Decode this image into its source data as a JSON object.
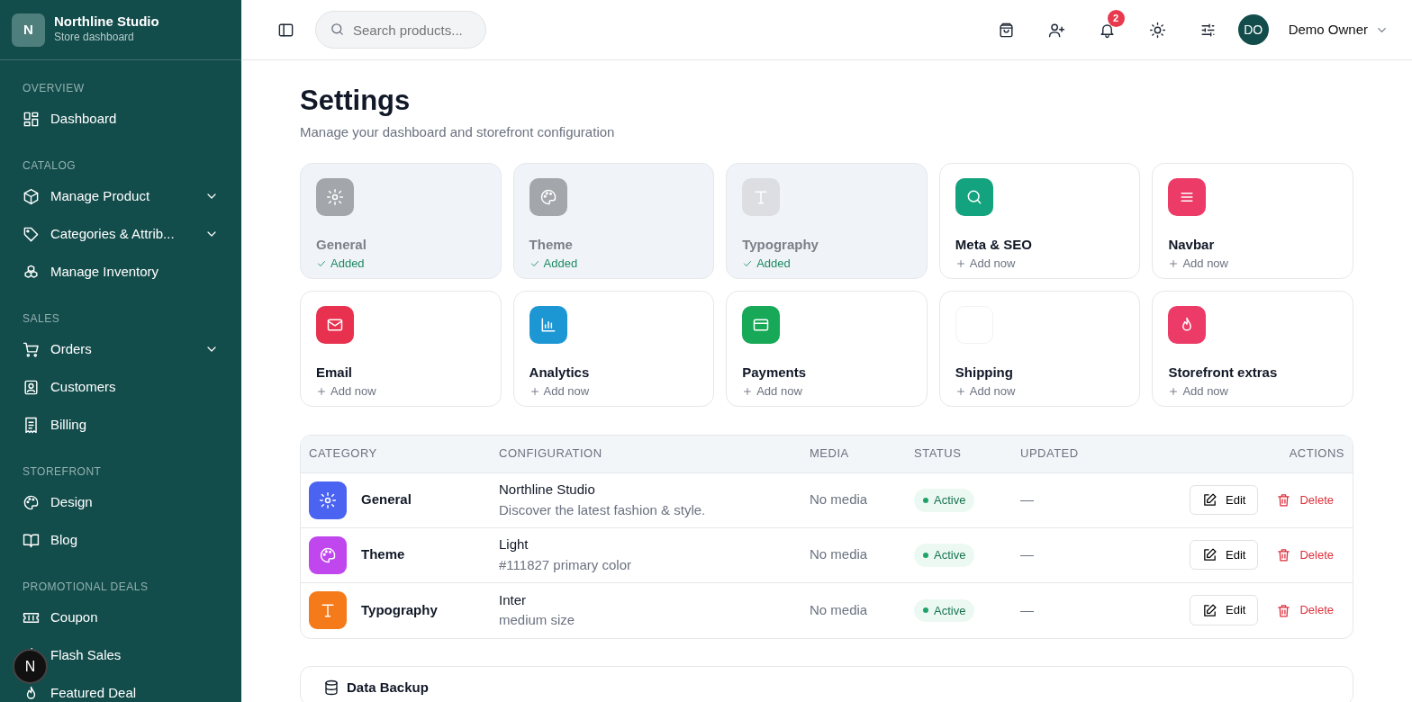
{
  "brand": {
    "initial": "N",
    "name": "Northline Studio",
    "subtitle": "Store dashboard"
  },
  "sidebar": {
    "sections": [
      {
        "title": "OVERVIEW",
        "items": [
          {
            "label": "Dashboard",
            "expandable": false
          }
        ]
      },
      {
        "title": "CATALOG",
        "items": [
          {
            "label": "Manage Product",
            "expandable": true
          },
          {
            "label": "Categories & Attrib...",
            "expandable": true
          },
          {
            "label": "Manage Inventory",
            "expandable": false
          }
        ]
      },
      {
        "title": "SALES",
        "items": [
          {
            "label": "Orders",
            "expandable": true
          },
          {
            "label": "Customers",
            "expandable": false
          },
          {
            "label": "Billing",
            "expandable": false
          }
        ]
      },
      {
        "title": "STOREFRONT",
        "items": [
          {
            "label": "Design",
            "expandable": false
          },
          {
            "label": "Blog",
            "expandable": false
          }
        ]
      },
      {
        "title": "PROMOTIONAL DEALS",
        "items": [
          {
            "label": "Coupon",
            "expandable": false
          },
          {
            "label": "Flash Sales",
            "expandable": false
          },
          {
            "label": "Featured Deal",
            "expandable": false
          }
        ]
      }
    ]
  },
  "dev_badge": "N",
  "topbar": {
    "search": {
      "placeholder": "Search products..."
    },
    "notification_count": "2",
    "user": {
      "initials": "DO",
      "name": "Demo Owner"
    }
  },
  "page": {
    "title": "Settings",
    "subtitle": "Manage your dashboard and storefront configuration"
  },
  "modules": [
    {
      "name": "General",
      "status": "Added",
      "added": true,
      "color": "#a3a6ab"
    },
    {
      "name": "Theme",
      "status": "Added",
      "added": true,
      "color": "#a3a6ab"
    },
    {
      "name": "Typography",
      "status": "Added",
      "added": true,
      "color": "#dcdee1"
    },
    {
      "name": "Meta & SEO",
      "status": "Add now",
      "added": false,
      "color": "#14a37f"
    },
    {
      "name": "Navbar",
      "status": "Add now",
      "added": false,
      "color": "#ec3b66"
    },
    {
      "name": "Email",
      "status": "Add now",
      "added": false,
      "color": "#e8314f"
    },
    {
      "name": "Analytics",
      "status": "Add now",
      "added": false,
      "color": "#1d97d4"
    },
    {
      "name": "Payments",
      "status": "Add now",
      "added": false,
      "color": "#17a957"
    },
    {
      "name": "Shipping",
      "status": "Add now",
      "added": false,
      "color": "#ffffff"
    },
    {
      "name": "Storefront extras",
      "status": "Add now",
      "added": false,
      "color": "#ec3b66"
    }
  ],
  "table": {
    "columns": [
      "CATEGORY",
      "CONFIGURATION",
      "MEDIA",
      "STATUS",
      "UPDATED",
      "ACTIONS"
    ],
    "rows": [
      {
        "category": "General",
        "color": "#4a63f0",
        "config_title": "Northline Studio",
        "config_detail": "Discover the latest fashion & style.",
        "media": "No media",
        "status": "Active",
        "updated": "—",
        "edit": "Edit",
        "delete": "Delete"
      },
      {
        "category": "Theme",
        "color": "#c046ee",
        "config_title": "Light",
        "config_detail": "#111827 primary color",
        "media": "No media",
        "status": "Active",
        "updated": "—",
        "edit": "Edit",
        "delete": "Delete"
      },
      {
        "category": "Typography",
        "color": "#f47a1a",
        "config_title": "Inter",
        "config_detail": "medium size",
        "media": "No media",
        "status": "Active",
        "updated": "—",
        "edit": "Edit",
        "delete": "Delete"
      }
    ]
  },
  "backup_card": {
    "title": "Data Backup"
  }
}
